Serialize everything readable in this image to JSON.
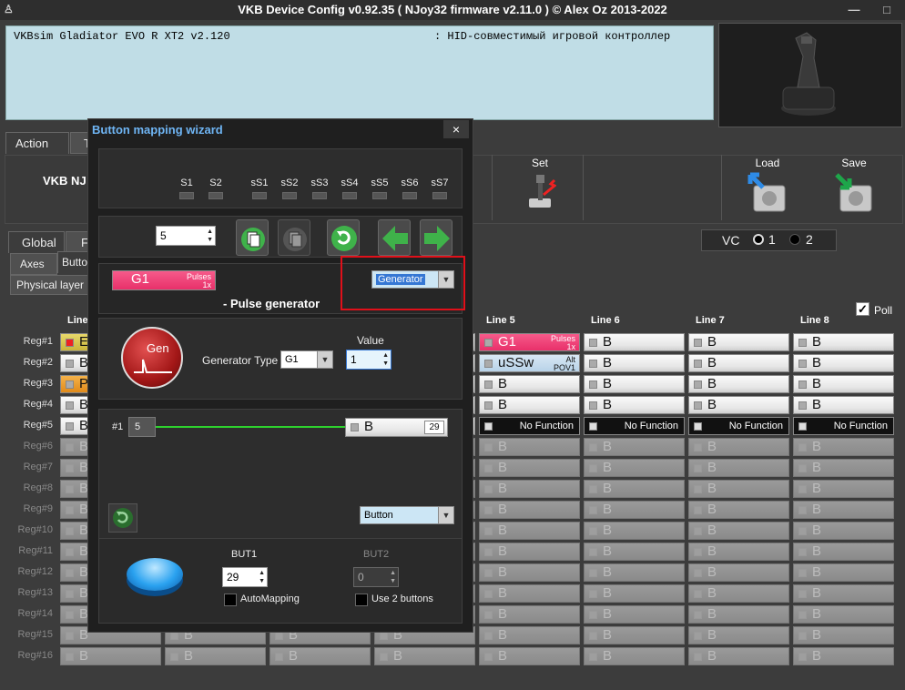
{
  "window": {
    "title": "VKB Device Config v0.92.35 ( NJoy32 firmware v2.11.0 ) © Alex Oz 2013-2022",
    "min": "—",
    "max": "□"
  },
  "device": {
    "name": "VKBsim Gladiator EVO  R  XT2 v2.120",
    "type": ": HID-совместимый игровой контроллер"
  },
  "tabs_main": [
    {
      "label": "Action"
    },
    {
      "label": "T"
    }
  ],
  "ribbon": {
    "device_label": "VKB NJ",
    "set": "Set",
    "load": "Load",
    "save": "Save"
  },
  "tabs_sub": [
    {
      "label": "Global"
    },
    {
      "label": "F"
    }
  ],
  "tabs_sub2": [
    {
      "label": "Axes"
    },
    {
      "label": "Butto"
    }
  ],
  "physical_layer": "Physical layer",
  "vc": {
    "label": "VC",
    "opt1": "1",
    "opt2": "2"
  },
  "poll": {
    "label": "Poll",
    "checked": "✓"
  },
  "grid": {
    "line_headers": [
      "Line",
      "Line 5",
      "Line 6",
      "Line 7",
      "Line 8"
    ],
    "rows": [
      "Reg#1",
      "Reg#2",
      "Reg#3",
      "Reg#4",
      "Reg#5",
      "Reg#6",
      "Reg#7",
      "Reg#8",
      "Reg#9",
      "Reg#10",
      "Reg#11",
      "Reg#12",
      "Reg#13",
      "Reg#14",
      "Reg#15",
      "Reg#16"
    ],
    "col1_partial": [
      "E",
      "B",
      "P",
      "B",
      "B"
    ],
    "b": "B",
    "line5_r1": {
      "main": "G1",
      "top": "Pulses",
      "bot": "1x"
    },
    "line5_r2": {
      "main": "uSSw",
      "top": "Alt",
      "bot": "POV1"
    },
    "no_function": "No Function"
  },
  "dialog": {
    "title": "Button mapping wizard",
    "close": "×",
    "shifts": [
      "S1",
      "S2",
      "sS1",
      "sS2",
      "sS3",
      "sS4",
      "sS5",
      "sS6",
      "sS7"
    ],
    "index_value": "5",
    "current": {
      "main": "G1",
      "top": "Pulses",
      "bot": "1x"
    },
    "type_combo": "Generator",
    "section_title": "- Pulse generator",
    "gen_icon": "Gen",
    "gen_type_label": "Generator Type",
    "gen_type_value": "G1",
    "value_label": "Value",
    "value": "1",
    "pulse": {
      "idx": "#1",
      "count": "5",
      "target": "B",
      "target_num": "29"
    },
    "button_combo": "Button",
    "but1_label": "BUT1",
    "but1_value": "29",
    "but2_label": "BUT2",
    "but2_value": "0",
    "automapping": "AutoMapping",
    "use2": "Use 2 buttons"
  },
  "colors": {
    "accent_red": "#e8306a",
    "title_blue": "#6fb5f4",
    "highlight": "#e0101a"
  }
}
